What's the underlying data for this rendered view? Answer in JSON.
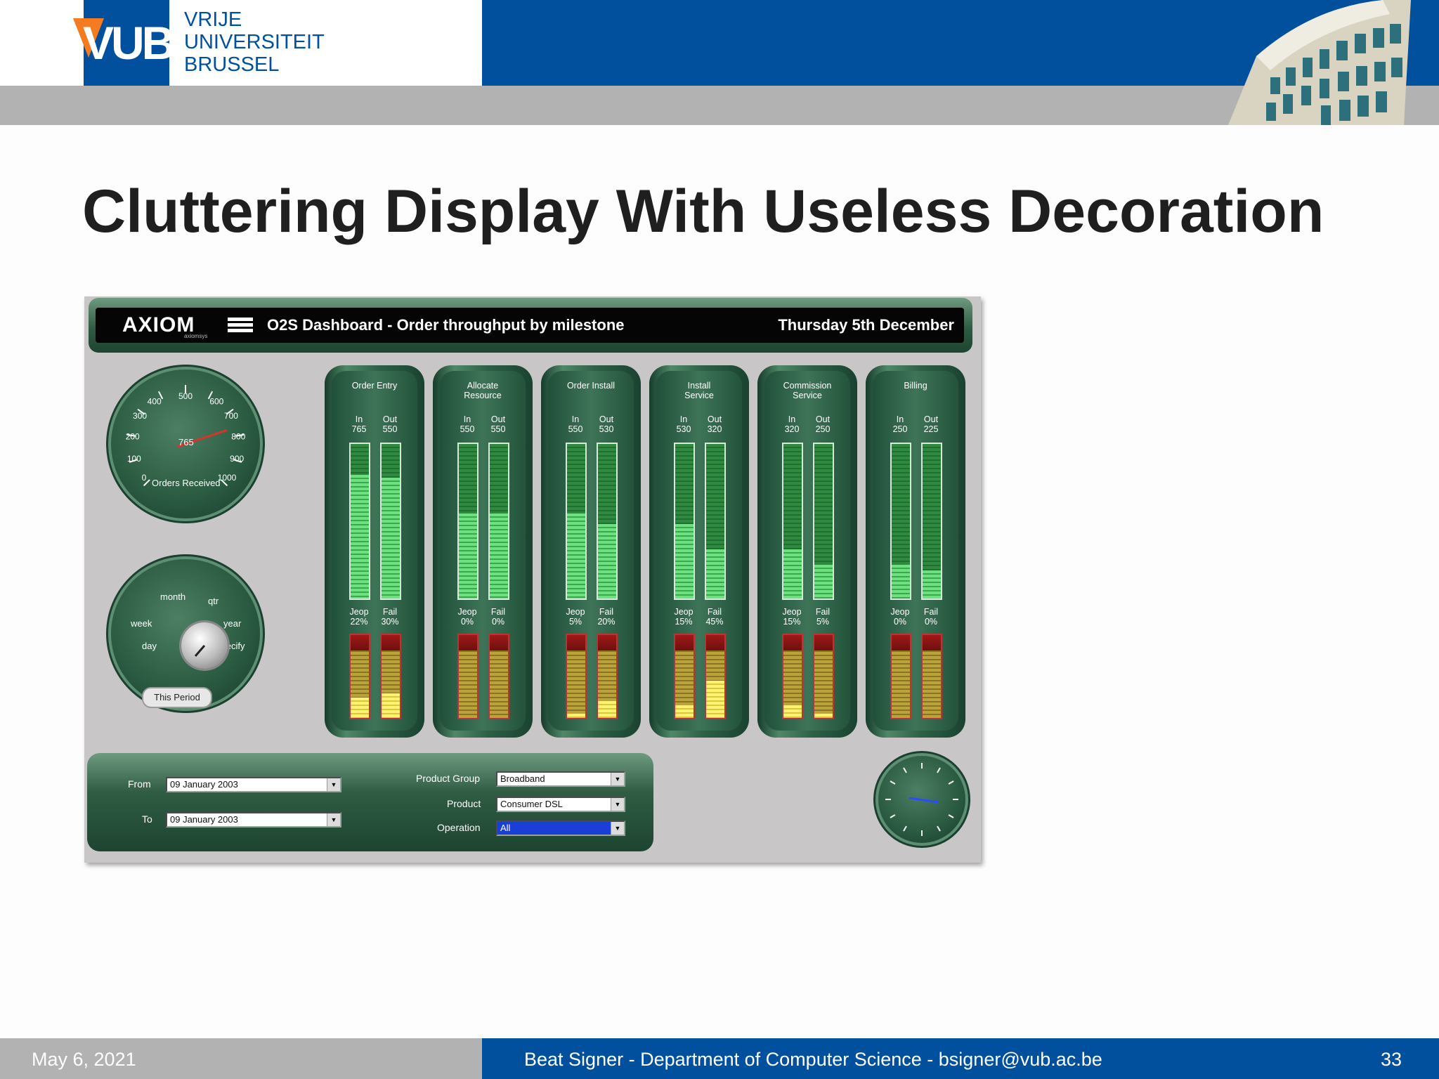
{
  "slide": {
    "logo": {
      "mark": "VUB",
      "line1": "VRIJE",
      "line2": "UNIVERSITEIT",
      "line3": "BRUSSEL"
    },
    "title": "Cluttering Display With Useless Decoration",
    "footer": {
      "date": "May 6, 2021",
      "center": "Beat Signer - Department of Computer Science - bsigner@vub.ac.be",
      "page": "33"
    },
    "colors": {
      "brand_blue": "#00509e",
      "band_gray": "#b2b2b2",
      "accent_orange": "#f47b20"
    }
  },
  "dashboard": {
    "brand": "AXIOM",
    "brand_sub": "axiomsys",
    "title": "O2S Dashboard - Order throughput by milestone",
    "date": "Thursday 5th December",
    "orders_dial": {
      "caption": "Orders Received",
      "value_label": "765",
      "value": 765,
      "max": 1000,
      "ticks": [
        "0",
        "100",
        "200",
        "300",
        "400",
        "500",
        "600",
        "700",
        "800",
        "900",
        "1000"
      ]
    },
    "period_dial": {
      "options": [
        "day",
        "week",
        "month",
        "qtr",
        "year",
        "specify"
      ],
      "button": "This Period"
    },
    "milestones": [
      {
        "title": "Order Entry",
        "in_label": "In",
        "out_label": "Out",
        "in": "765",
        "out": "550",
        "in_level": 0.8,
        "out_level": 0.78,
        "jeop_label": "Jeop",
        "fail_label": "Fail",
        "jeop": "22%",
        "fail": "30%",
        "jeop_level": 0.25,
        "fail_level": 0.3
      },
      {
        "title": "Allocate\nResource",
        "in_label": "In",
        "out_label": "Out",
        "in": "550",
        "out": "550",
        "in_level": 0.55,
        "out_level": 0.55,
        "jeop_label": "Jeop",
        "fail_label": "Fail",
        "jeop": "0%",
        "fail": "0%",
        "jeop_level": 0.0,
        "fail_level": 0.0
      },
      {
        "title": "Order Install",
        "in_label": "In",
        "out_label": "Out",
        "in": "550",
        "out": "530",
        "in_level": 0.55,
        "out_level": 0.48,
        "jeop_label": "Jeop",
        "fail_label": "Fail",
        "jeop": "5%",
        "fail": "20%",
        "jeop_level": 0.05,
        "fail_level": 0.2
      },
      {
        "title": "Install\nService",
        "in_label": "In",
        "out_label": "Out",
        "in": "530",
        "out": "320",
        "in_level": 0.48,
        "out_level": 0.32,
        "jeop_label": "Jeop",
        "fail_label": "Fail",
        "jeop": "15%",
        "fail": "45%",
        "jeop_level": 0.15,
        "fail_level": 0.45
      },
      {
        "title": "Commission\nService",
        "in_label": "In",
        "out_label": "Out",
        "in": "320",
        "out": "250",
        "in_level": 0.32,
        "out_level": 0.22,
        "jeop_label": "Jeop",
        "fail_label": "Fail",
        "jeop": "15%",
        "fail": "5%",
        "jeop_level": 0.15,
        "fail_level": 0.05
      },
      {
        "title": "Billing",
        "in_label": "In",
        "out_label": "Out",
        "in": "250",
        "out": "225",
        "in_level": 0.22,
        "out_level": 0.18,
        "jeop_label": "Jeop",
        "fail_label": "Fail",
        "jeop": "0%",
        "fail": "0%",
        "jeop_level": 0.0,
        "fail_level": 0.0
      }
    ],
    "filters": {
      "from_label": "From",
      "from_value": "09   January   2003",
      "to_label": "To",
      "to_value": "09   January   2003",
      "product_group_label": "Product Group",
      "product_group_value": "Broadband",
      "product_label": "Product",
      "product_value": "Consumer DSL",
      "operation_label": "Operation",
      "operation_value": "All"
    }
  }
}
